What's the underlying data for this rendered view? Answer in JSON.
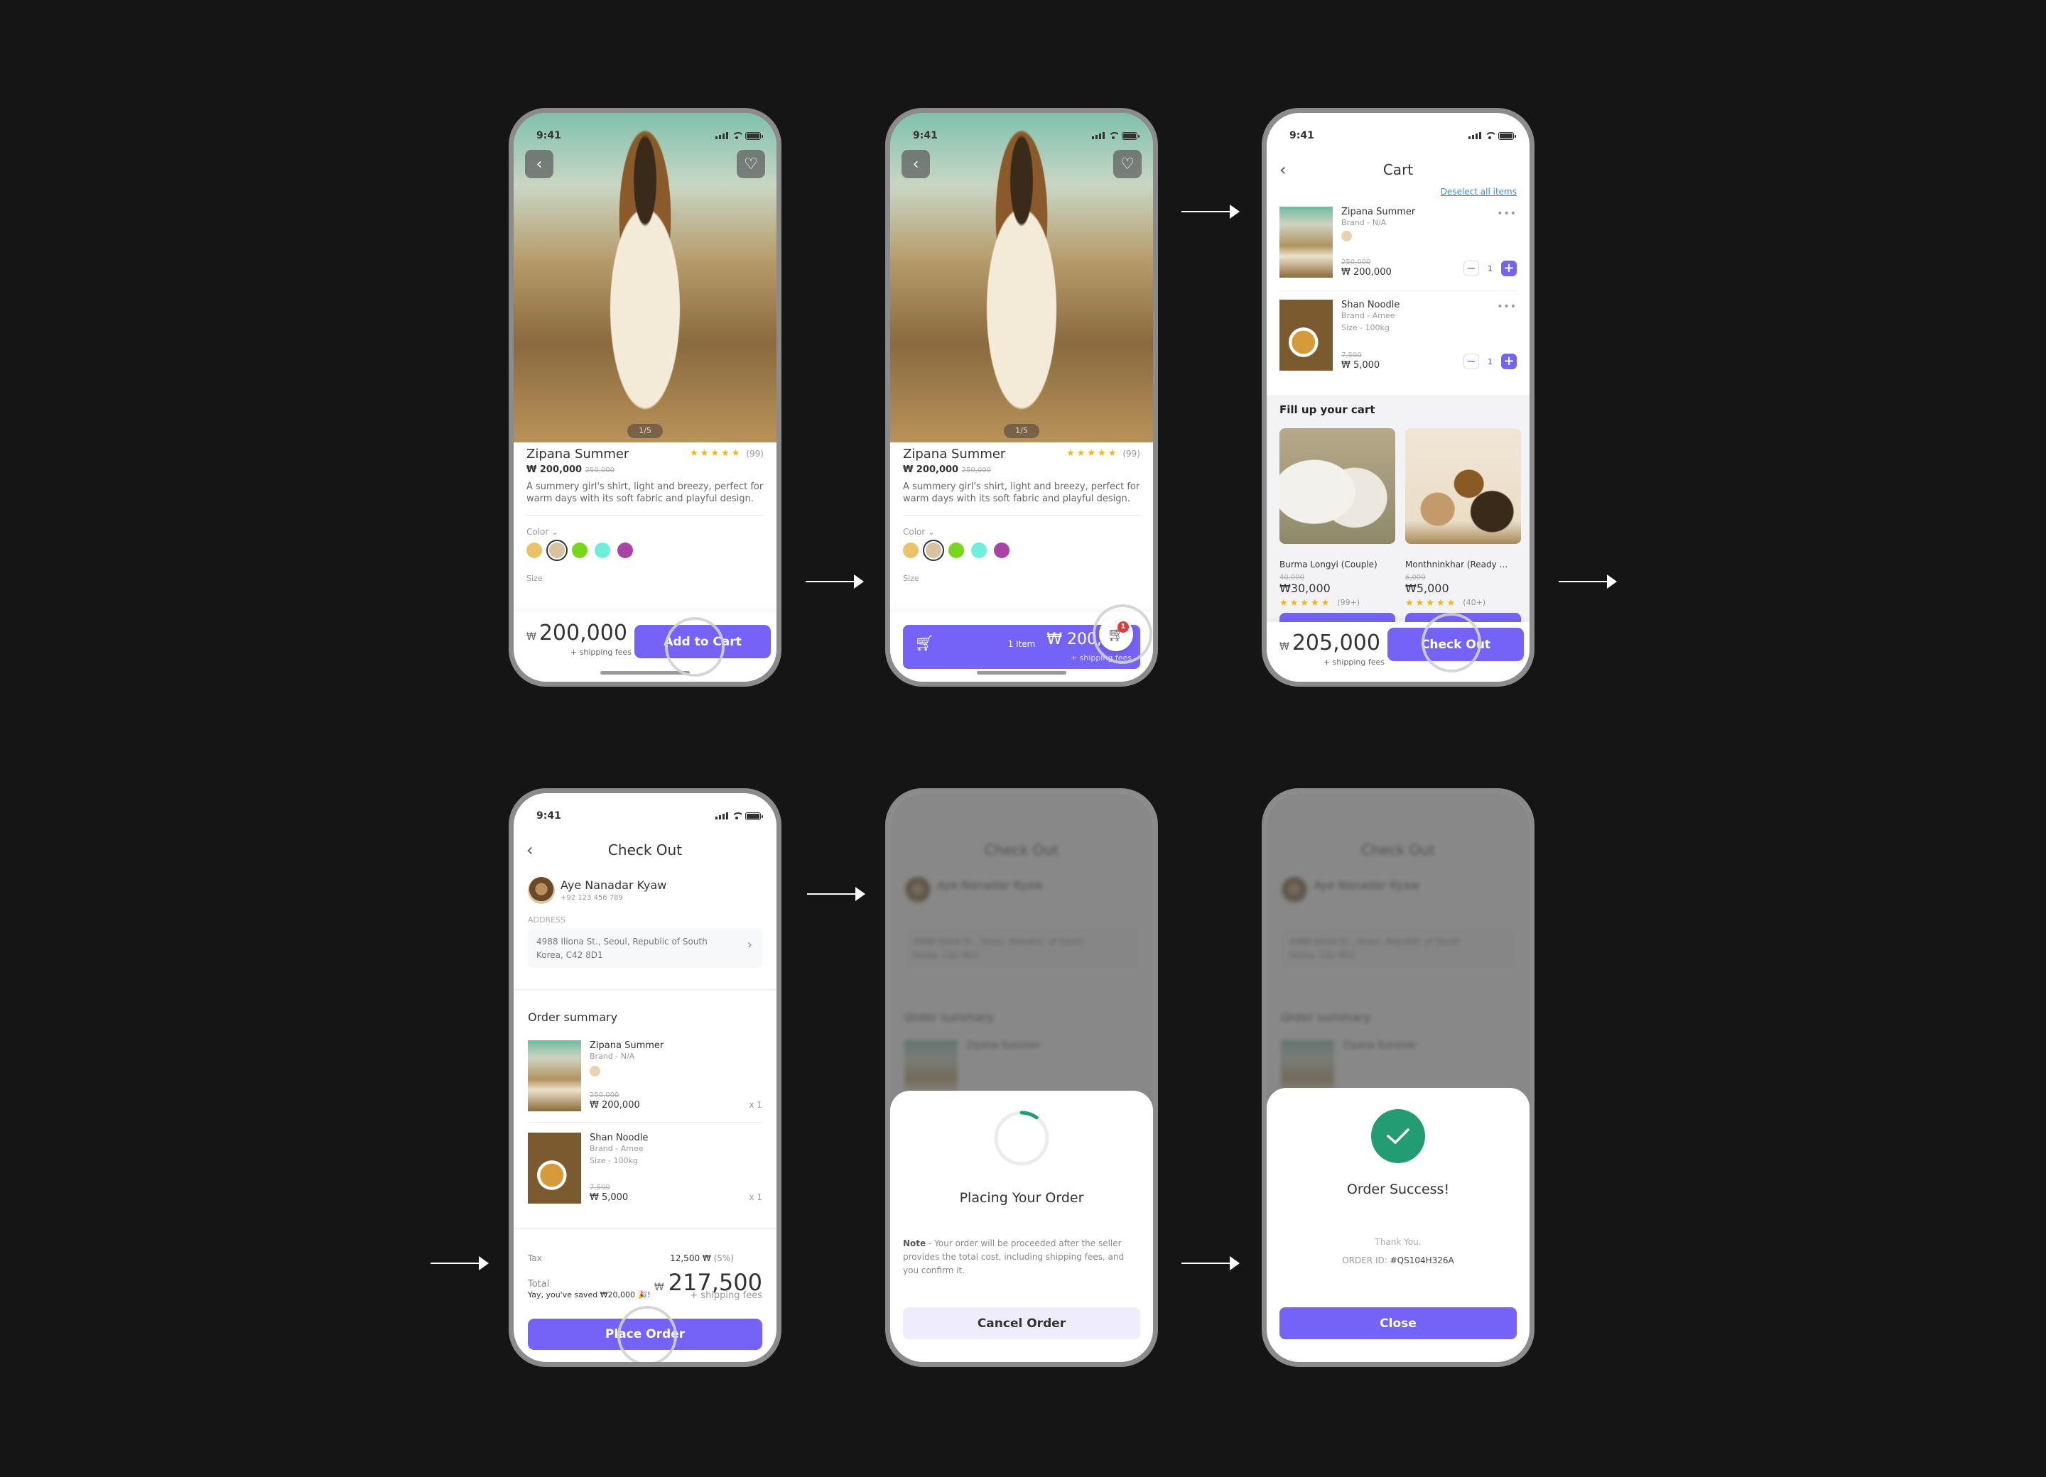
{
  "status_time": "9:41",
  "product_screen": {
    "pager": "1/5",
    "name": "Zipana Summer",
    "rating_count": "(99)",
    "rating_value": 4.5,
    "currency": "₩",
    "price": "200,000",
    "old_price": "250,000",
    "description": "A summery girl's shirt, light and breezy, perfect for warm days with its soft fabric and playful design.",
    "color_label": "Color",
    "colors": [
      "#ecc26a",
      "#d8c2a0",
      "#7ad61d",
      "#6eeedb",
      "#a943a8"
    ],
    "selected_color_index": 1,
    "size_label": "Size",
    "total": "200,000",
    "shipping_note": "+ shipping fees",
    "add_to_cart": "Add to Cart"
  },
  "product_added_screen": {
    "cart_badge": "1",
    "cart_items": "1 Item",
    "cart_total": "₩ 200,000",
    "shipping_note": "+ shipping fees"
  },
  "cart_screen": {
    "title": "Cart",
    "deselect": "Deselect all items",
    "items": [
      {
        "name": "Zipana Summer",
        "brand": "Brand - N/A",
        "size": "",
        "old_price": "250,000",
        "price": "₩ 200,000",
        "qty": "1"
      },
      {
        "name": "Shan Noodle",
        "brand": "Brand - Amee",
        "size": "Size - 100kg",
        "old_price": "7,500",
        "price": "₩ 5,000",
        "qty": "1"
      }
    ],
    "fill_up_title": "Fill up your cart",
    "recommendations": [
      {
        "name": "Burma Longyi (Couple)",
        "old_price": "40,000",
        "price": "₩30,000",
        "rating_count": "(99+)"
      },
      {
        "name": "Monthninkhar (Ready ...",
        "old_price": "6,000",
        "price": "₩5,000",
        "rating_count": "(40+)"
      }
    ],
    "total": "205,000",
    "shipping_note": "+ shipping fees",
    "checkout": "Check Out"
  },
  "checkout_screen": {
    "title": "Check Out",
    "user_name": "Aye Nanadar Kyaw",
    "user_phone": "+92 123 456 789",
    "address_label": "ADDRESS",
    "address": "4988 Iliona St., Seoul, Republic of South Korea, C42 8D1",
    "order_summary": "Order summary",
    "items": [
      {
        "name": "Zipana Summer",
        "brand": "Brand - N/A",
        "size": "",
        "old_price": "250,000",
        "price": "₩ 200,000",
        "qty": "x 1"
      },
      {
        "name": "Shan Noodle",
        "brand": "Brand - Amee",
        "size": "Size - 100kg",
        "old_price": "7,500",
        "price": "₩ 5,000",
        "qty": "x 1"
      }
    ],
    "tax_label": "Tax",
    "tax_value": "12,500 ₩",
    "tax_pct": "(5%)",
    "total_label": "Total",
    "total": "217,500",
    "saved": "Yay, you've saved ₩20,000 🎉!",
    "shipping_note": "+ shipping fees",
    "place_order": "Place Order"
  },
  "placing_modal": {
    "title": "Placing Your Order",
    "progress": 0.1,
    "note_label": "Note",
    "note": " - Your order will be proceeded after the seller provides the total cost, including shipping fees, and you confirm it.",
    "cancel": "Cancel Order"
  },
  "success_modal": {
    "title": "Order Success!",
    "thanks": "Thank You.",
    "order_id_label": "ORDER ID: ",
    "order_id": "#QS104H326A",
    "close": "Close"
  },
  "colors": {
    "accent": "#7563f7",
    "success": "#239c74",
    "star": "#f5b50a",
    "link": "#2f8ff0",
    "badge": "#e53935"
  }
}
